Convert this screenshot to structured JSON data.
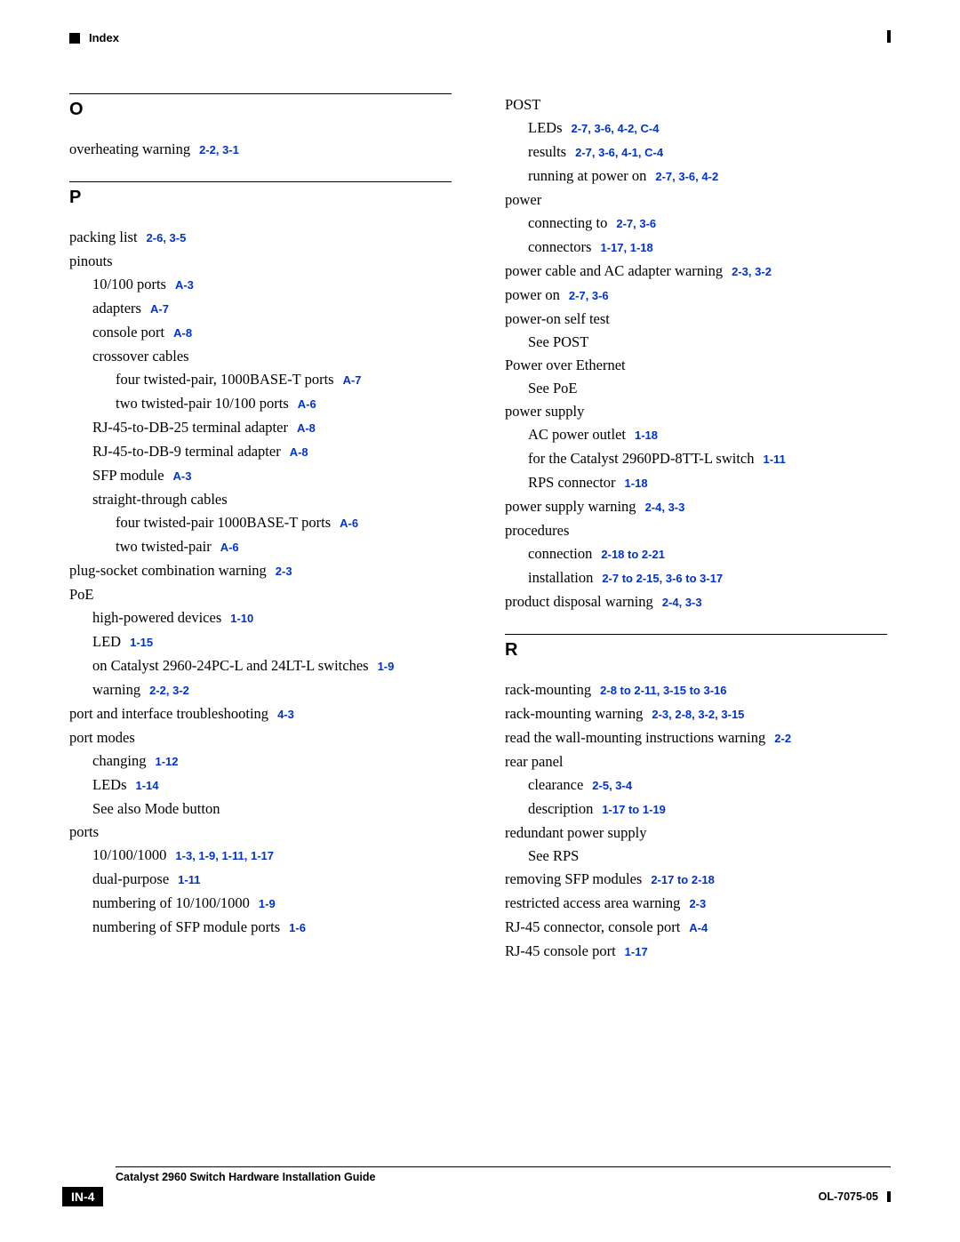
{
  "header": {
    "label": "Index"
  },
  "footer": {
    "title": "Catalyst 2960 Switch Hardware Installation Guide",
    "page": "IN-4",
    "docid": "OL-7075-05"
  },
  "letters": {
    "O": "O",
    "P": "P",
    "R": "R"
  },
  "left": [
    {
      "type": "rule"
    },
    {
      "type": "letter",
      "key": "O"
    },
    {
      "i": 0,
      "t": "overheating warning",
      "r": "2-2, 3-1"
    },
    {
      "type": "sp"
    },
    {
      "type": "rule"
    },
    {
      "type": "letter",
      "key": "P"
    },
    {
      "i": 0,
      "t": "packing list",
      "r": "2-6, 3-5"
    },
    {
      "i": 0,
      "t": "pinouts"
    },
    {
      "i": 1,
      "t": "10/100 ports",
      "r": "A-3"
    },
    {
      "i": 1,
      "t": "adapters",
      "r": "A-7"
    },
    {
      "i": 1,
      "t": "console port",
      "r": "A-8"
    },
    {
      "i": 1,
      "t": "crossover cables"
    },
    {
      "i": 2,
      "t": "four twisted-pair, 1000BASE-T ports",
      "r": "A-7"
    },
    {
      "i": 2,
      "t": "two twisted-pair 10/100 ports",
      "r": "A-6"
    },
    {
      "i": 1,
      "t": "RJ-45-to-DB-25 terminal adapter",
      "r": "A-8"
    },
    {
      "i": 1,
      "t": "RJ-45-to-DB-9 terminal adapter",
      "r": "A-8"
    },
    {
      "i": 1,
      "t": "SFP module",
      "r": "A-3"
    },
    {
      "i": 1,
      "t": "straight-through cables"
    },
    {
      "i": 2,
      "t": "four twisted-pair 1000BASE-T ports",
      "r": "A-6"
    },
    {
      "i": 2,
      "t": "two twisted-pair",
      "r": "A-6"
    },
    {
      "i": 0,
      "t": "plug-socket combination warning",
      "r": "2-3"
    },
    {
      "i": 0,
      "t": "PoE"
    },
    {
      "i": 1,
      "t": "high-powered devices",
      "r": "1-10"
    },
    {
      "i": 1,
      "t": "LED",
      "r": "1-15"
    },
    {
      "i": 1,
      "t": "on Catalyst 2960-24PC-L and 24LT-L switches",
      "r": "1-9"
    },
    {
      "i": 1,
      "t": "warning",
      "r": "2-2, 3-2"
    },
    {
      "i": 0,
      "t": "port and interface troubleshooting",
      "r": "4-3"
    },
    {
      "i": 0,
      "t": "port modes"
    },
    {
      "i": 1,
      "t": "changing",
      "r": "1-12"
    },
    {
      "i": 1,
      "t": "LEDs",
      "r": "1-14"
    },
    {
      "i": 1,
      "t": "See also Mode button"
    },
    {
      "i": 0,
      "t": "ports"
    },
    {
      "i": 1,
      "t": "10/100/1000",
      "r": "1-3, 1-9, 1-11, 1-17"
    },
    {
      "i": 1,
      "t": "dual-purpose",
      "r": "1-11"
    },
    {
      "i": 1,
      "t": "numbering of 10/100/1000",
      "r": "1-9"
    },
    {
      "i": 1,
      "t": "numbering of SFP module ports",
      "r": "1-6"
    }
  ],
  "right": [
    {
      "i": 0,
      "t": "POST"
    },
    {
      "i": 1,
      "t": "LEDs",
      "r": "2-7, 3-6, 4-2, C-4"
    },
    {
      "i": 1,
      "t": "results",
      "r": "2-7, 3-6, 4-1, C-4"
    },
    {
      "i": 1,
      "t": "running at power on",
      "r": "2-7, 3-6, 4-2"
    },
    {
      "i": 0,
      "t": "power"
    },
    {
      "i": 1,
      "t": "connecting to",
      "r": "2-7, 3-6"
    },
    {
      "i": 1,
      "t": "connectors",
      "r": "1-17, 1-18"
    },
    {
      "i": 0,
      "t": "power cable and AC adapter warning",
      "r": "2-3, 3-2"
    },
    {
      "i": 0,
      "t": "power on",
      "r": "2-7, 3-6"
    },
    {
      "i": 0,
      "t": "power-on self test"
    },
    {
      "i": 1,
      "t": "See POST"
    },
    {
      "i": 0,
      "t": "Power over Ethernet"
    },
    {
      "i": 1,
      "t": "See PoE"
    },
    {
      "i": 0,
      "t": "power supply"
    },
    {
      "i": 1,
      "t": "AC power outlet",
      "r": "1-18"
    },
    {
      "i": 1,
      "t": "for the Catalyst 2960PD-8TT-L switch",
      "r": "1-11"
    },
    {
      "i": 1,
      "t": "RPS connector",
      "r": "1-18"
    },
    {
      "i": 0,
      "t": "power supply warning",
      "r": "2-4, 3-3"
    },
    {
      "i": 0,
      "t": "procedures"
    },
    {
      "i": 1,
      "t": "connection",
      "r": "2-18 to 2-21"
    },
    {
      "i": 1,
      "t": "installation",
      "r": "2-7 to 2-15, 3-6 to 3-17"
    },
    {
      "i": 0,
      "t": "product disposal warning",
      "r": "2-4, 3-3"
    },
    {
      "type": "sp"
    },
    {
      "type": "rule"
    },
    {
      "type": "letter",
      "key": "R"
    },
    {
      "i": 0,
      "t": "rack-mounting",
      "r": "2-8 to 2-11, 3-15 to 3-16"
    },
    {
      "i": 0,
      "t": "rack-mounting warning",
      "r": "2-3, 2-8, 3-2, 3-15"
    },
    {
      "i": 0,
      "t": "read the wall-mounting instructions warning",
      "r": "2-2"
    },
    {
      "i": 0,
      "t": "rear panel"
    },
    {
      "i": 1,
      "t": "clearance",
      "r": "2-5, 3-4"
    },
    {
      "i": 1,
      "t": "description",
      "r": "1-17 to 1-19"
    },
    {
      "i": 0,
      "t": "redundant power supply"
    },
    {
      "i": 1,
      "t": "See RPS"
    },
    {
      "i": 0,
      "t": "removing SFP modules",
      "r": "2-17 to 2-18"
    },
    {
      "i": 0,
      "t": "restricted access area warning",
      "r": "2-3"
    },
    {
      "i": 0,
      "t": "RJ-45 connector, console port",
      "r": "A-4"
    },
    {
      "i": 0,
      "t": "RJ-45 console port",
      "r": "1-17"
    }
  ]
}
